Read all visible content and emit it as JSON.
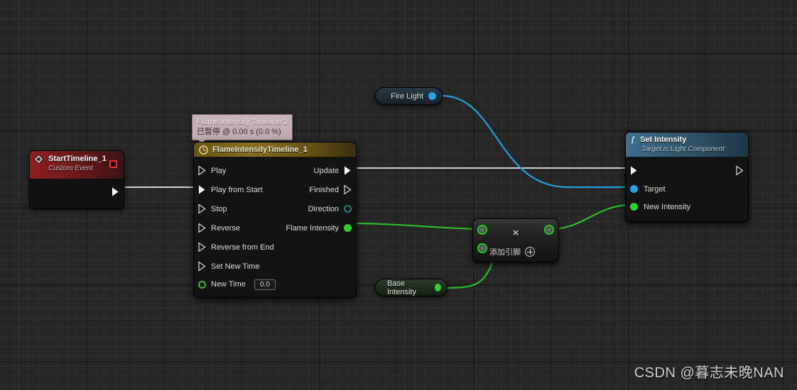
{
  "app": {
    "name": "Unreal Engine Blueprint Graph",
    "watermark": "CSDN @暮志未晚NAN"
  },
  "tooltip": {
    "line1": "Flame Intensity Timeline 1",
    "line2": "已暂停 @ 0.00 s (0.0 %)"
  },
  "nodes": {
    "start_timeline": {
      "title": "StartTimeline_1",
      "subtitle": "Custom Event",
      "icon": "event-diamond-icon",
      "stop_icon": "stop-square-icon"
    },
    "timeline": {
      "title": "FlameIntensityTimeline_1",
      "icon": "clock-icon",
      "inputs": [
        {
          "label": "Play",
          "pin": "exec-hollow"
        },
        {
          "label": "Play from Start",
          "pin": "exec-filled"
        },
        {
          "label": "Stop",
          "pin": "exec-hollow"
        },
        {
          "label": "Reverse",
          "pin": "exec-hollow"
        },
        {
          "label": "Reverse from End",
          "pin": "exec-hollow"
        },
        {
          "label": "Set New Time",
          "pin": "exec-hollow"
        }
      ],
      "outputs": [
        {
          "label": "Update",
          "pin": "exec-filled"
        },
        {
          "label": "Finished",
          "pin": "exec-hollow"
        },
        {
          "label": "Direction",
          "pin": "ring-teal"
        },
        {
          "label": "Flame Intensity",
          "pin": "dot-green"
        }
      ],
      "new_time": {
        "label": "New Time",
        "value": "0.0",
        "pin": "ring-green"
      }
    },
    "set_intensity": {
      "title": "Set Intensity",
      "subtitle": "Target is Light Component",
      "f_glyph": "f",
      "exec_in": "exec-filled",
      "exec_out": "exec-hollow",
      "pins": [
        {
          "label": "Target",
          "pin": "dot-blue"
        },
        {
          "label": "New Intensity",
          "pin": "dot-green"
        }
      ]
    },
    "fire_light": {
      "label": "Fire Light",
      "pin": "dot-blue"
    },
    "base_intensity": {
      "label": "Base Intensity",
      "pin": "dot-green"
    },
    "multiply": {
      "operator": "×",
      "add_pin_label": "添加引脚",
      "add_pin_icon": "plus-circle-icon",
      "inputs": [
        "wildcard-a",
        "wildcard-b"
      ],
      "outputs": [
        "wildcard-out"
      ]
    }
  },
  "colors": {
    "exec_wire": "#d2d2d2",
    "object_wire": "#1f9fe0",
    "float_wire": "#2bbf2b",
    "event_header": "#8c1f1f",
    "timeline_header": "#8a6f1e",
    "function_header": "#3f6f8e",
    "canvas_bg": "#262626"
  }
}
